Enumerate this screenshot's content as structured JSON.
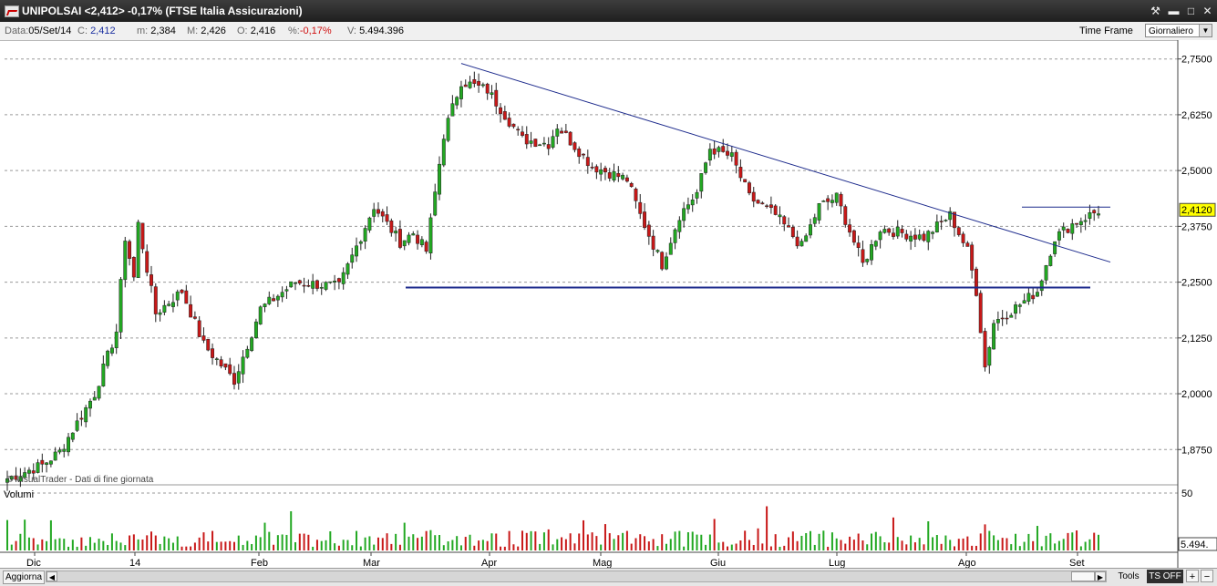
{
  "window": {
    "title": "UNIPOLSAI <2,412> -0,17%  (FTSE Italia Assicurazioni)",
    "buttons": {
      "tools": "⚒",
      "minimize": "▬",
      "maximize": "□",
      "close": "✕"
    }
  },
  "info": {
    "date_label": "Data:",
    "date": "05/Set/14",
    "close_label": "C:",
    "close": "2,412",
    "min_label": "m:",
    "min": "2,384",
    "max_label": "M:",
    "max": "2,426",
    "open_label": "O:",
    "open": "2,416",
    "pct_label": "%:",
    "pct": "-0,17%",
    "vol_label": "V:",
    "volume": "5.494.396",
    "timeframe_label": "Time Frame",
    "timeframe_value": "Giornaliero"
  },
  "colors": {
    "up": "#22a822",
    "down": "#c81818",
    "trend": "#1c2a8c",
    "price_tag": "#ffff00"
  },
  "chart_data": {
    "type": "candlestick",
    "price_axis": {
      "ylim": [
        1.8,
        2.78
      ],
      "ticks": [
        "2,7500",
        "2,6250",
        "2,5000",
        "2,3750",
        "2,2500",
        "2,1250",
        "2,0000",
        "1,8750"
      ]
    },
    "last_price_tag": "2,4120",
    "volume_axis": {
      "ticks": [
        "50"
      ],
      "last_value": "5.494."
    },
    "volume_label": "Volumi",
    "copyright": "© VisualTrader - Dati di fine giornata",
    "x_labels": [
      "Dic",
      "14",
      "Feb",
      "Mar",
      "Apr",
      "Mag",
      "Giu",
      "Lug",
      "Ago",
      "Set"
    ],
    "anchors": [
      [
        0,
        1.81
      ],
      [
        8,
        1.84
      ],
      [
        12,
        1.87
      ],
      [
        20,
        2.0
      ],
      [
        25,
        2.14
      ],
      [
        27,
        2.35
      ],
      [
        29,
        2.26
      ],
      [
        30,
        2.38
      ],
      [
        34,
        2.18
      ],
      [
        40,
        2.23
      ],
      [
        45,
        2.11
      ],
      [
        52,
        2.03
      ],
      [
        58,
        2.19
      ],
      [
        66,
        2.25
      ],
      [
        76,
        2.24
      ],
      [
        84,
        2.42
      ],
      [
        90,
        2.34
      ],
      [
        93,
        2.36
      ],
      [
        96,
        2.32
      ],
      [
        100,
        2.58
      ],
      [
        104,
        2.7
      ],
      [
        110,
        2.68
      ],
      [
        118,
        2.57
      ],
      [
        124,
        2.56
      ],
      [
        126,
        2.6
      ],
      [
        134,
        2.51
      ],
      [
        142,
        2.48
      ],
      [
        145,
        2.4
      ],
      [
        150,
        2.29
      ],
      [
        154,
        2.4
      ],
      [
        158,
        2.45
      ],
      [
        161,
        2.55
      ],
      [
        166,
        2.53
      ],
      [
        170,
        2.44
      ],
      [
        176,
        2.4
      ],
      [
        182,
        2.33
      ],
      [
        186,
        2.42
      ],
      [
        190,
        2.44
      ],
      [
        196,
        2.29
      ],
      [
        200,
        2.37
      ],
      [
        210,
        2.35
      ],
      [
        216,
        2.4
      ],
      [
        220,
        2.32
      ],
      [
        222,
        2.23
      ],
      [
        224,
        2.06
      ],
      [
        226,
        2.16
      ],
      [
        232,
        2.2
      ],
      [
        236,
        2.23
      ],
      [
        240,
        2.35
      ],
      [
        244,
        2.38
      ],
      [
        250,
        2.41
      ]
    ]
  }
}
